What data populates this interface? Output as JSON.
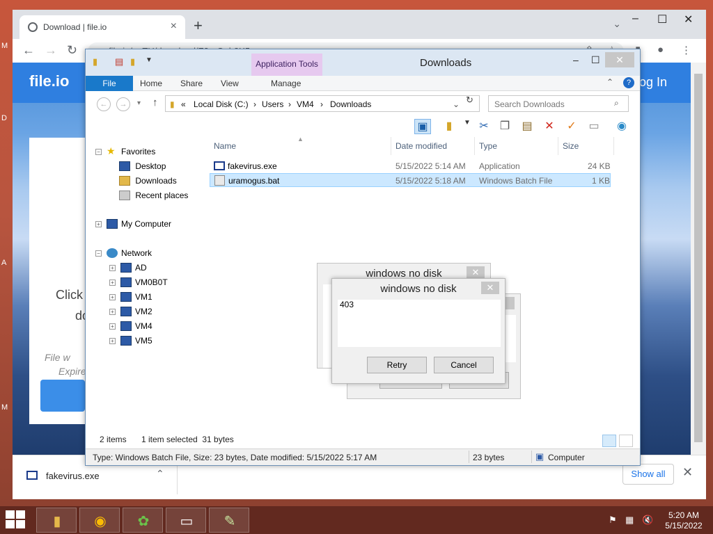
{
  "browser": {
    "tab_title": "Download | file.io",
    "url": "file.io/geTU/download/F3raOgb2X5cw",
    "downloads_bar": {
      "file_name": "fakevirus.exe",
      "show_all_label": "Show all"
    }
  },
  "site": {
    "logo": "file.io",
    "login": "og In",
    "click_text": "Click",
    "do_text": "do",
    "file_text": "File w",
    "expire_text": "Expire"
  },
  "explorer": {
    "title": "Downloads",
    "app_tools": "Application Tools",
    "ribbon_tabs": [
      "File",
      "Home",
      "Share",
      "View",
      "Manage"
    ],
    "breadcrumb": [
      "«",
      "Local Disk (C:)",
      "Users",
      "VM4",
      "Downloads"
    ],
    "search_placeholder": "Search Downloads",
    "columns": [
      "Name",
      "Date modified",
      "Type",
      "Size"
    ],
    "files": [
      {
        "name": "fakevirus.exe",
        "date": "5/15/2022 5:14 AM",
        "type": "Application",
        "size": "24 KB"
      },
      {
        "name": "uramogus.bat",
        "date": "5/15/2022 5:18 AM",
        "type": "Windows Batch File",
        "size": "1 KB"
      }
    ],
    "nav": {
      "favorites": "Favorites",
      "favorite_items": [
        "Desktop",
        "Downloads",
        "Recent places"
      ],
      "my_computer": "My Computer",
      "network": "Network",
      "network_items": [
        "AD",
        "VM0B0T",
        "VM1",
        "VM2",
        "VM4",
        "VM5"
      ]
    },
    "status_items": "2 items",
    "status_selected": "1 item selected  31 bytes",
    "details_text": "Type: Windows Batch File, Size: 23 bytes, Date modified: 5/15/2022 5:17 AM",
    "details_size": "23 bytes",
    "details_location": "Computer"
  },
  "dialog": {
    "title": "windows no disk",
    "message": "403",
    "retry_label": "Retry",
    "cancel_label": "Cancel"
  },
  "taskbar": {
    "time": "5:20 AM",
    "date": "5/15/2022"
  }
}
